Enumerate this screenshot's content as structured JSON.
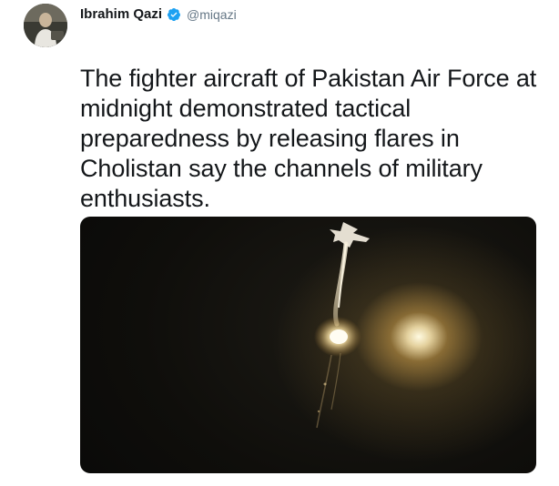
{
  "tweet": {
    "author": {
      "display_name": "Ibrahim Qazi",
      "handle": "@miqazi",
      "verified": true,
      "avatar_icon": "profile-photo"
    },
    "text": "The fighter aircraft of Pakistan Air Force at midnight demonstrated tactical preparedness by releasing flares in Cholistan say the channels of military enthusiasts.",
    "media": {
      "type": "video-still",
      "icon": "night-sky-aircraft-flares"
    }
  },
  "colors": {
    "text": "#14171a",
    "secondary": "#657786",
    "verified_blue": "#1da1f2",
    "media_background": "#0f0e0b"
  }
}
